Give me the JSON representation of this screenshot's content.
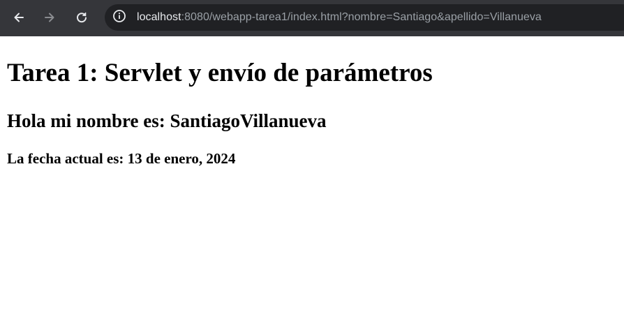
{
  "browser": {
    "back_icon": "arrow-left-icon",
    "forward_icon": "arrow-right-icon",
    "reload_icon": "reload-icon",
    "site_info_icon": "info-icon",
    "url": {
      "host": "localhost",
      "rest": ":8080/webapp-tarea1/index.html?nombre=Santiago&apellido=Villanueva"
    },
    "colors": {
      "toolbar": "#35363a",
      "omnibox": "#202124",
      "host_text": "#e8eaed",
      "path_text": "#9aa0a6"
    }
  },
  "page": {
    "title": "Tarea 1: Servlet y envío de parámetros",
    "greeting": "Hola mi nombre es: SantiagoVillanueva",
    "date": "La fecha actual es: 13 de enero, 2024"
  }
}
